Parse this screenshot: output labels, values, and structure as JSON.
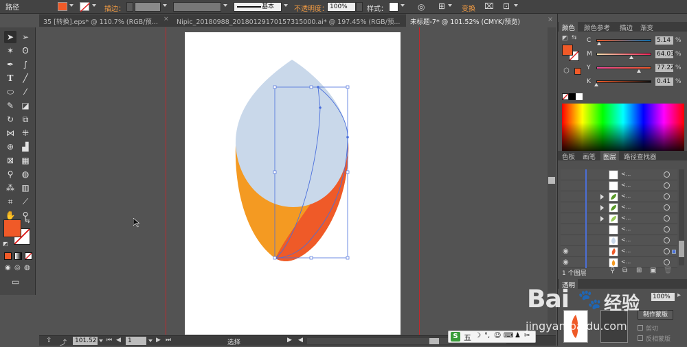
{
  "control_bar": {
    "object_type": "路径",
    "stroke_label": "描边：",
    "stroke_profile": "基本",
    "opacity_label": "不透明度：",
    "opacity_value": "100%",
    "style_label": "样式：",
    "transform_label": "变换"
  },
  "tabs": [
    {
      "label": "35 [转换].eps* @ 110.7% (RGB/预...",
      "active": false
    },
    {
      "label": "Nipic_20180988_20180129170157315000.ai* @ 197.45% (RGB/预...",
      "active": false
    },
    {
      "label": "未标题-7* @ 101.52% (CMYK/预览)",
      "active": true
    }
  ],
  "tools": [
    "selection-tool",
    "direct-selection-tool",
    "magic-wand-tool",
    "lasso-tool",
    "pen-tool",
    "curvature-tool",
    "type-tool",
    "line-tool",
    "ellipse-tool",
    "paintbrush-tool",
    "pencil-tool",
    "eraser-tool",
    "rotate-tool",
    "scale-tool",
    "width-tool",
    "free-transform-tool",
    "shape-builder-tool",
    "perspective-grid-tool",
    "mesh-tool",
    "gradient-tool",
    "eyedropper-tool",
    "blend-tool",
    "symbol-sprayer-tool",
    "column-graph-tool",
    "artboard-tool",
    "slice-tool",
    "hand-tool",
    "zoom-tool"
  ],
  "colors": {
    "fill": "#f05a28",
    "petal_blue": "#c9d8ea",
    "petal_orange_light": "#f49a22",
    "petal_orange_dark": "#ef5a28",
    "selection": "#4a6fdc",
    "guide": "#c0282d"
  },
  "color_panel": {
    "tabs": [
      "颜色",
      "颜色参考",
      "描边",
      "渐变"
    ],
    "channels": [
      {
        "name": "C",
        "value": "5.14",
        "pct": 5.14
      },
      {
        "name": "M",
        "value": "64.03",
        "pct": 64.03
      },
      {
        "name": "Y",
        "value": "77.22",
        "pct": 77.22
      },
      {
        "name": "K",
        "value": "0.41",
        "pct": 0.41
      }
    ],
    "percent_sign": "%"
  },
  "layers_panel": {
    "tabs": [
      "色板",
      "画笔",
      "图层",
      "路径查找器"
    ],
    "rows": [
      {
        "name": "<...",
        "thumb": "blank",
        "expand": false,
        "visible": false
      },
      {
        "name": "<...",
        "thumb": "blank",
        "expand": false,
        "visible": false
      },
      {
        "name": "<...",
        "thumb": "leaf",
        "expand": true,
        "visible": false
      },
      {
        "name": "<...",
        "thumb": "leaf",
        "expand": true,
        "visible": false
      },
      {
        "name": "<...",
        "thumb": "leaf-light",
        "expand": true,
        "visible": false
      },
      {
        "name": "<...",
        "thumb": "blank",
        "expand": false,
        "visible": false
      },
      {
        "name": "<...",
        "thumb": "petal-blue",
        "expand": false,
        "visible": false
      },
      {
        "name": "<...",
        "thumb": "petal-orange-red",
        "expand": false,
        "visible": true
      },
      {
        "name": "<...",
        "thumb": "petal-orange",
        "expand": false,
        "visible": true
      }
    ],
    "layer_count": "1 个图层"
  },
  "transparency_panel": {
    "tab": "透明",
    "opacity_value": "100%",
    "make_mask_label": "制作蒙版",
    "clip_label": "剪切",
    "invert_mask_label": "反相蒙版"
  },
  "status_bar": {
    "zoom": "101.52",
    "artboard_index": "1",
    "tool_name": "选择"
  },
  "ime_bar": {
    "mode": "五"
  },
  "watermark": {
    "brand": "Bai",
    "brand_suffix": "经验",
    "url": "jingyan.baidu.com"
  }
}
